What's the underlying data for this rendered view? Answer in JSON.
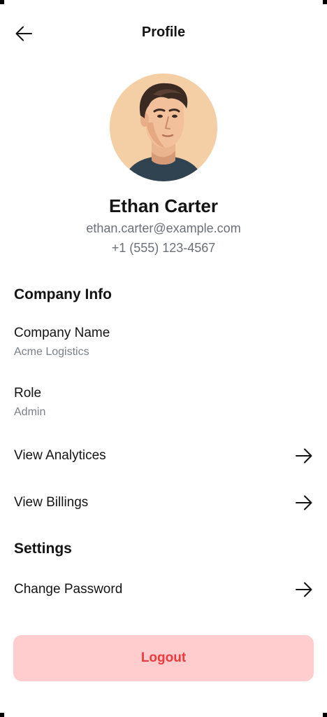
{
  "header": {
    "title": "Profile",
    "back_icon": "arrow-left-icon"
  },
  "user": {
    "name": "Ethan Carter",
    "email": "ethan.carter@example.com",
    "phone": "+1 (555) 123-4567",
    "avatar": "avatar-illustration"
  },
  "company_section": {
    "title": "Company Info",
    "fields": [
      {
        "label": "Company Name",
        "value": "Acme Logistics"
      },
      {
        "label": "Role",
        "value": "Admin"
      }
    ],
    "links": [
      {
        "label": "View Analytices",
        "icon": "arrow-right-icon"
      },
      {
        "label": "View Billings",
        "icon": "arrow-right-icon"
      }
    ]
  },
  "settings_section": {
    "title": "Settings",
    "links": [
      {
        "label": "Change Password",
        "icon": "arrow-right-icon"
      }
    ]
  },
  "logout": {
    "label": "Logout",
    "bg_color": "#ffcdcd",
    "text_color": "#f0393d"
  }
}
